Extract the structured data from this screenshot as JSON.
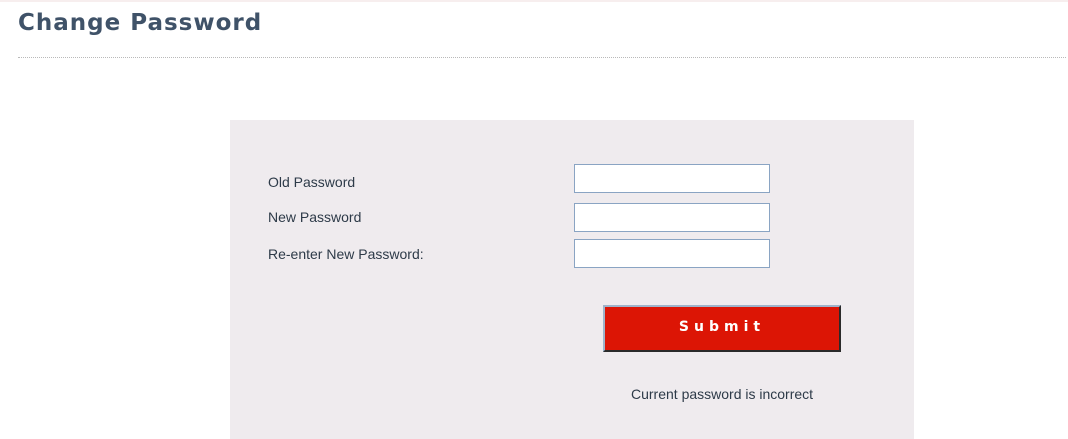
{
  "page": {
    "title": "Change Password"
  },
  "form": {
    "old_password_label": "Old Password",
    "new_password_label": "New Password",
    "reenter_password_label": "Re-enter New Password:",
    "old_password_value": "",
    "new_password_value": "",
    "reenter_password_value": "",
    "submit_label": "Submit",
    "status_message": "Current password is incorrect"
  },
  "colors": {
    "title": "#3f5268",
    "panel_background": "#efebee",
    "submit_background": "#dc1505",
    "input_border": "#8aa4c3"
  }
}
